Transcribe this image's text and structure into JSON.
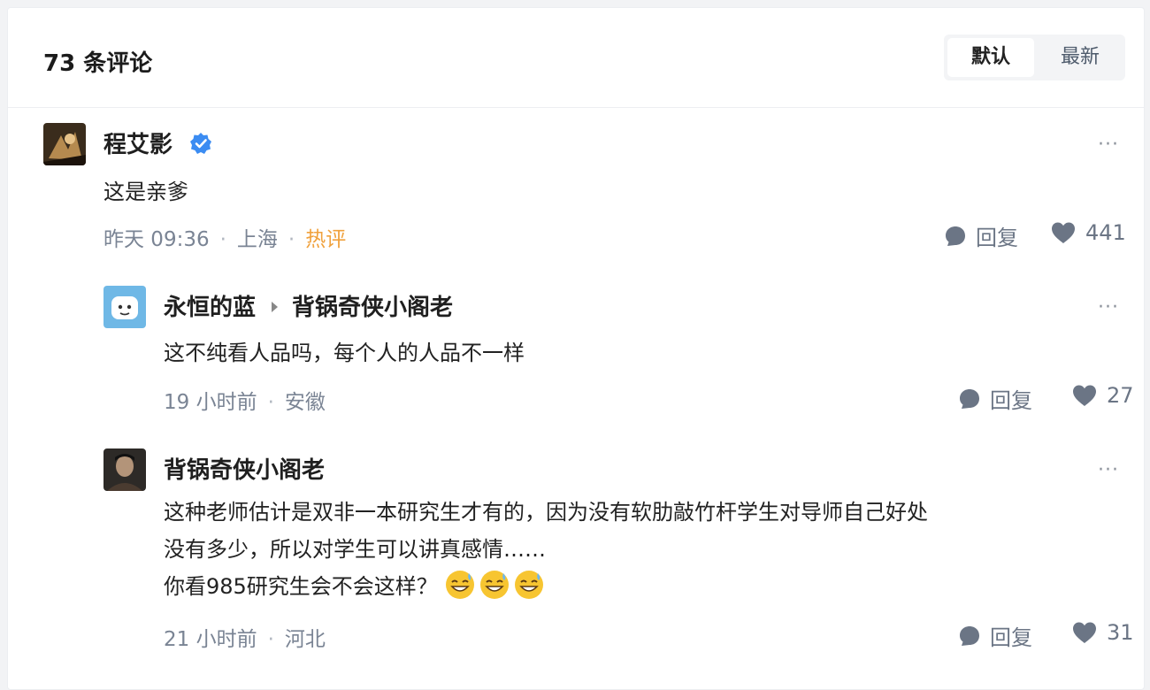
{
  "header": {
    "comment_count": "73 条评论",
    "sort_options": [
      "默认",
      "最新"
    ]
  },
  "comments": [
    {
      "author": "程艾影",
      "verified": true,
      "content": "这是亲爹",
      "time": "昨天 09:36",
      "location": "上海",
      "badge": "热评",
      "reply_label": "回复",
      "likes": "441",
      "more": "···"
    },
    {
      "author": "永恒的蓝",
      "reply_to": "背锅奇侠小阁老",
      "content": "这不纯看人品吗，每个人的人品不一样",
      "time": "19 小时前",
      "location": "安徽",
      "reply_label": "回复",
      "likes": "27",
      "more": "···"
    },
    {
      "author": "背锅奇侠小阁老",
      "content_lines": [
        "这种老师估计是双非一本研究生才有的，因为没有软肋敲竹杆学生对导师自己好处",
        "没有多少，所以对学生可以讲真感情……",
        "你看985研究生会不会这样？"
      ],
      "emojis": [
        "sweat-smile-emoji",
        "sweat-smile-emoji",
        "sweat-smile-emoji"
      ],
      "time": "21 小时前",
      "location": "河北",
      "reply_label": "回复",
      "likes": "31",
      "more": "···"
    }
  ],
  "colors": {
    "hot_badge": "#f0a13c",
    "verified": "#3b8cf2",
    "meta": "#7a8494"
  }
}
